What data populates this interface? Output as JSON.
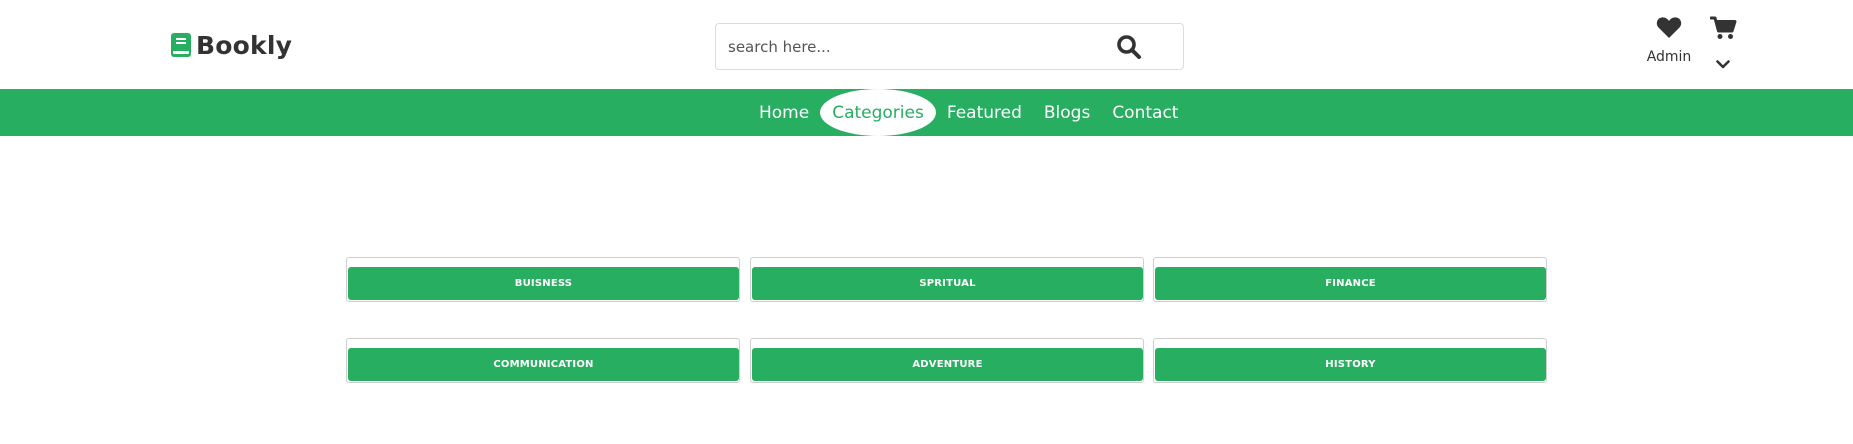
{
  "header": {
    "logo_text": "Bookly",
    "logo_icon": "book-icon",
    "search": {
      "placeholder": "search here...",
      "icon": "search-icon"
    },
    "wishlist": {
      "icon": "heart-icon",
      "label": "Admin"
    },
    "cart": {
      "icon": "cart-icon",
      "dropdown_icon": "chevron-down-icon"
    }
  },
  "nav": {
    "items": [
      {
        "label": "Home"
      },
      {
        "label": "Categories",
        "active": true
      },
      {
        "label": "Featured"
      },
      {
        "label": "Blogs"
      },
      {
        "label": "Contact"
      }
    ]
  },
  "categories": [
    {
      "label": "BUISNESS"
    },
    {
      "label": "SPRITUAL"
    },
    {
      "label": "FINANCE"
    },
    {
      "label": "COMMUNICATION"
    },
    {
      "label": "ADVENTURE"
    },
    {
      "label": "HISTORY"
    }
  ],
  "colors": {
    "accent": "#27ae60",
    "text": "#333333",
    "background": "#ffffff"
  }
}
